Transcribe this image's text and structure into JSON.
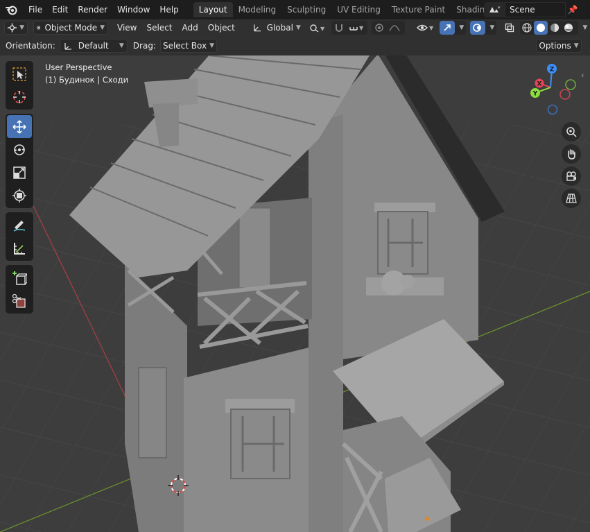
{
  "menubar": {
    "items": [
      "File",
      "Edit",
      "Render",
      "Window",
      "Help"
    ]
  },
  "workspaces": {
    "tabs": [
      "Layout",
      "Modeling",
      "Sculpting",
      "UV Editing",
      "Texture Paint",
      "Shading"
    ],
    "active": "Layout"
  },
  "scene": {
    "name": "Scene"
  },
  "header": {
    "mode": "Object Mode",
    "menus": [
      "View",
      "Select",
      "Add",
      "Object"
    ],
    "transform_orientation": "Global"
  },
  "tool_settings": {
    "orientation_label": "Orientation:",
    "orientation_value": "Default",
    "drag_label": "Drag:",
    "drag_value": "Select Box",
    "options_label": "Options"
  },
  "viewport": {
    "perspective": "User Perspective",
    "active_object": "(1) Будинок | Сходи"
  },
  "gizmo": {
    "z_label": "Z",
    "y_label": "Y",
    "x_label": "X"
  },
  "colors": {
    "accent": "#4772b3",
    "x_axis": "#e54556",
    "y_axis": "#8bdc3e",
    "z_axis": "#3d8fff"
  }
}
